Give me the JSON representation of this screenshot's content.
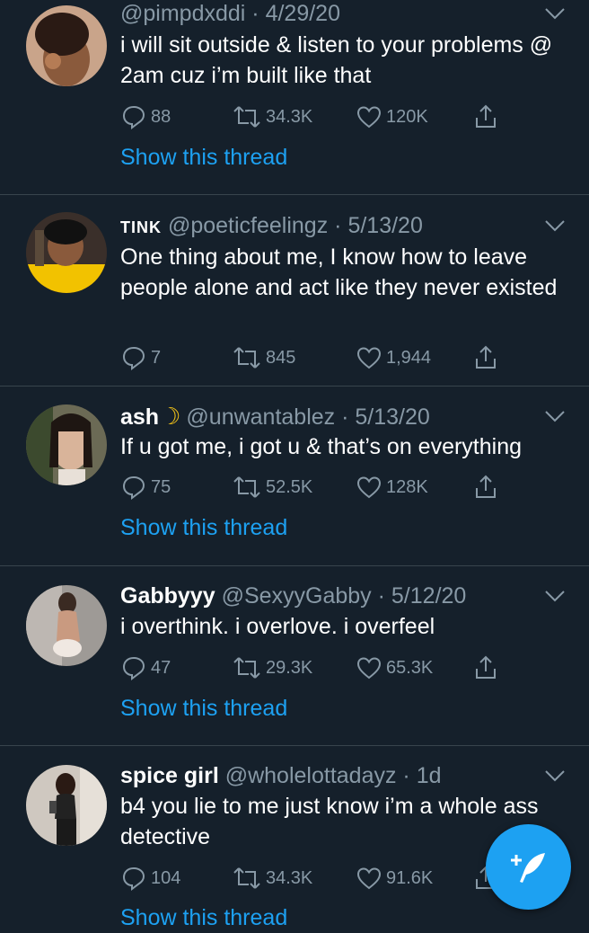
{
  "tweets": [
    {
      "display_name": "",
      "handle": "@pimpdxddi",
      "date": "4/29/20",
      "text": "i will sit outside & listen to your problems @ 2am cuz i’m built like that",
      "replies": "88",
      "retweets": "34.3K",
      "likes": "120K",
      "show_thread": "Show this thread"
    },
    {
      "display_name": "TINK",
      "handle": "@poeticfeelingz",
      "date": "5/13/20",
      "text": "One thing about me, I know how to leave people alone and act like they never existed",
      "replies": "7",
      "retweets": "845",
      "likes": "1,944",
      "show_thread": ""
    },
    {
      "display_name": "ash",
      "handle": "@unwantablez",
      "date": "5/13/20",
      "text": "If u got me, i got u & that’s on everything",
      "replies": "75",
      "retweets": "52.5K",
      "likes": "128K",
      "show_thread": "Show this thread"
    },
    {
      "display_name": "Gabbyyy",
      "handle": "@SexyyGabby",
      "date": "5/12/20",
      "text": "i overthink. i overlove. i overfeel",
      "replies": "47",
      "retweets": "29.3K",
      "likes": "65.3K",
      "show_thread": "Show this thread"
    },
    {
      "display_name": "spice girl",
      "handle": "@wholelottadayz",
      "date": "1d",
      "text": "b4 you lie to me just know i’m a whole ass detective",
      "replies": "104",
      "retweets": "34.3K",
      "likes": "91.6K",
      "show_thread": "Show this thread"
    }
  ],
  "separator": " · ",
  "compose_icon": "compose-tweet-icon",
  "colors": {
    "background": "#15202b",
    "secondary_text": "#8899a6",
    "accent": "#1da1f2",
    "divider": "#38444d"
  }
}
